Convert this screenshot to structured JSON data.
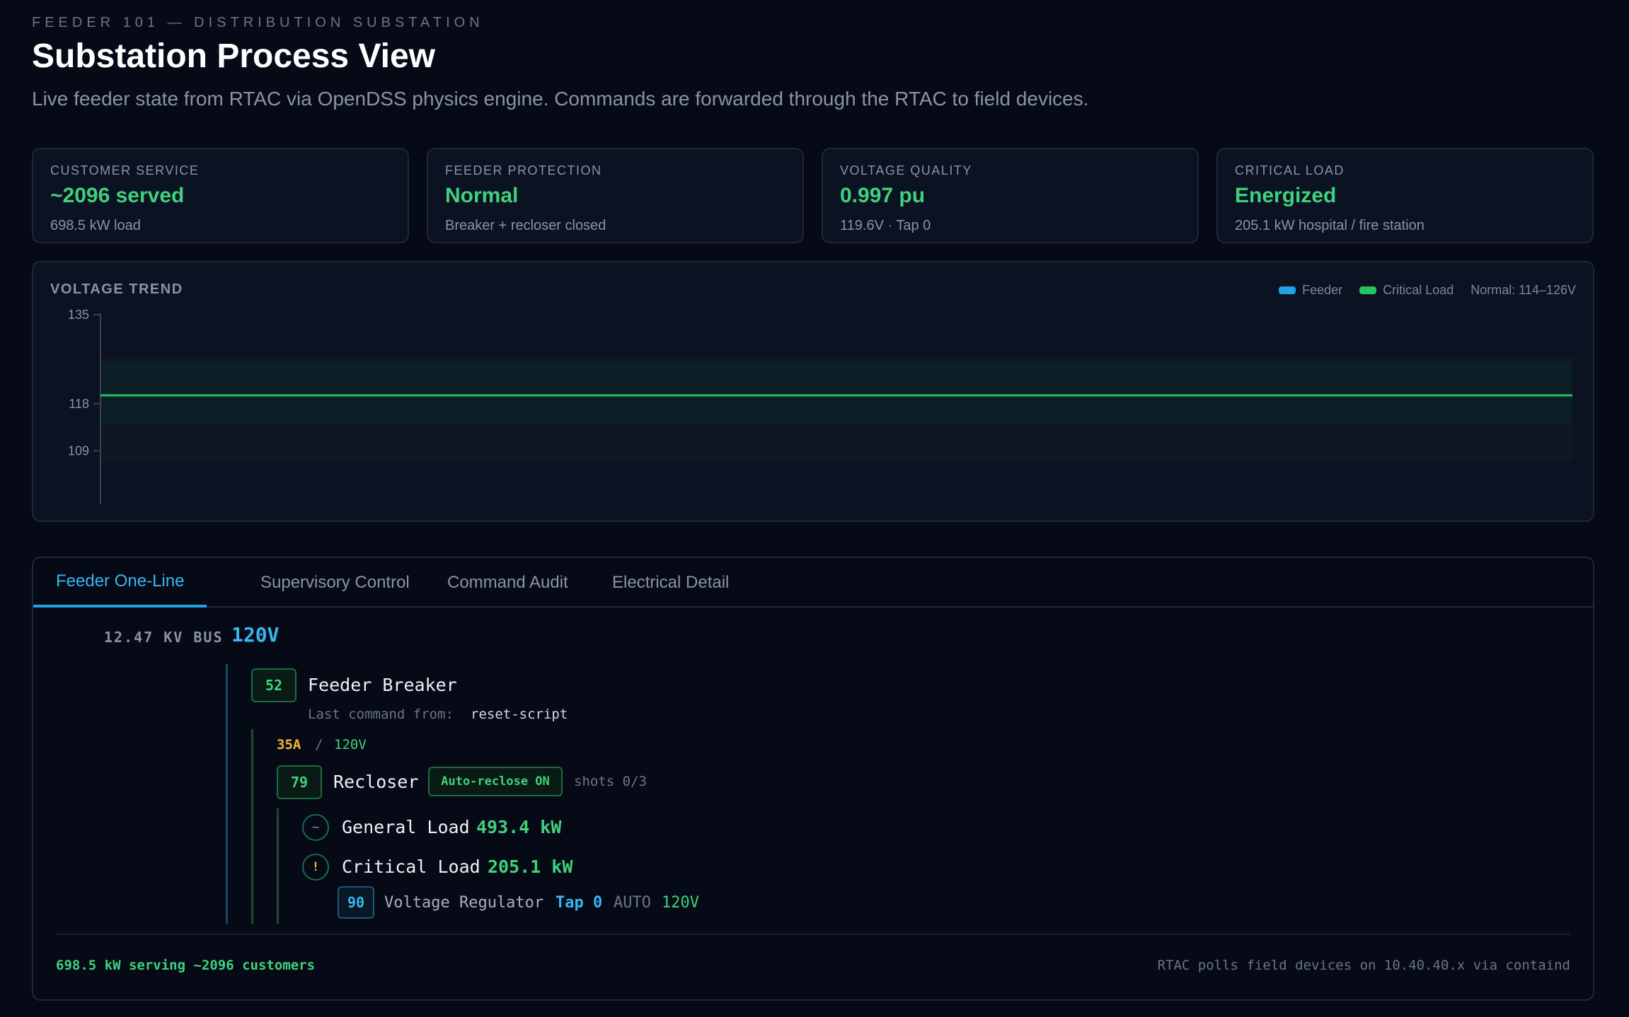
{
  "header": {
    "eyebrow": "FEEDER 101 — DISTRIBUTION SUBSTATION",
    "title": "Substation Process View",
    "subtitle": "Live feeder state from RTAC via OpenDSS physics engine. Commands are forwarded through the RTAC to field devices."
  },
  "kpis": [
    {
      "label": "CUSTOMER SERVICE",
      "value": "~2096 served",
      "sub": "698.5 kW load"
    },
    {
      "label": "FEEDER PROTECTION",
      "value": "Normal",
      "sub": "Breaker + recloser closed"
    },
    {
      "label": "VOLTAGE QUALITY",
      "value": "0.997 pu",
      "sub": "119.6V · Tap 0"
    },
    {
      "label": "CRITICAL LOAD",
      "value": "Energized",
      "sub": "205.1 kW hospital / fire station"
    }
  ],
  "trend": {
    "title": "VOLTAGE TREND",
    "legend": {
      "feeder": "Feeder",
      "critical": "Critical Load",
      "normal": "Normal: 114–126V"
    }
  },
  "chart_data": {
    "type": "line",
    "title": "VOLTAGE TREND",
    "ylim": [
      100,
      135
    ],
    "yticks": [
      "135",
      "118",
      "109"
    ],
    "normal_band": [
      114,
      126
    ],
    "series": [
      {
        "name": "Feeder",
        "values": [
          119.6,
          119.6,
          119.6,
          119.6,
          119.6,
          119.6,
          119.6,
          119.6,
          119.6,
          119.6
        ]
      },
      {
        "name": "Critical Load",
        "values": [
          119.6,
          119.6,
          119.6,
          119.6,
          119.6,
          119.6,
          119.6,
          119.6,
          119.6,
          119.6
        ]
      }
    ],
    "colors": {
      "feeder": "#1fa2e6",
      "critical": "#22c55e"
    }
  },
  "tabs": [
    "Feeder One-Line",
    "Supervisory Control",
    "Command Audit",
    "Electrical Detail"
  ],
  "oneline": {
    "bus_label": "12.47 KV BUS",
    "bus_voltage": "120V",
    "breaker_id": "52",
    "breaker_name": "Feeder Breaker",
    "last_cmd_label": "Last command from:",
    "last_cmd_value": "reset-script",
    "current": "35A",
    "slash": "/",
    "line_voltage": "120V",
    "recloser_id": "79",
    "recloser_name": "Recloser",
    "autoreclose": "Auto-reclose ON",
    "shots": "shots 0/3",
    "general_icon": "~",
    "general_name": "General Load",
    "general_kw": "493.4 kW",
    "critical_icon": "!",
    "critical_name": "Critical Load",
    "critical_kw": "205.1 kW",
    "regulator_id": "90",
    "regulator_name": "Voltage Regulator",
    "tap": "Tap 0",
    "mode": "AUTO",
    "reg_voltage": "120V"
  },
  "footer": {
    "summary": "698.5 kW serving ~2096 customers",
    "note": "RTAC polls field devices on 10.40.40.x via containd"
  }
}
